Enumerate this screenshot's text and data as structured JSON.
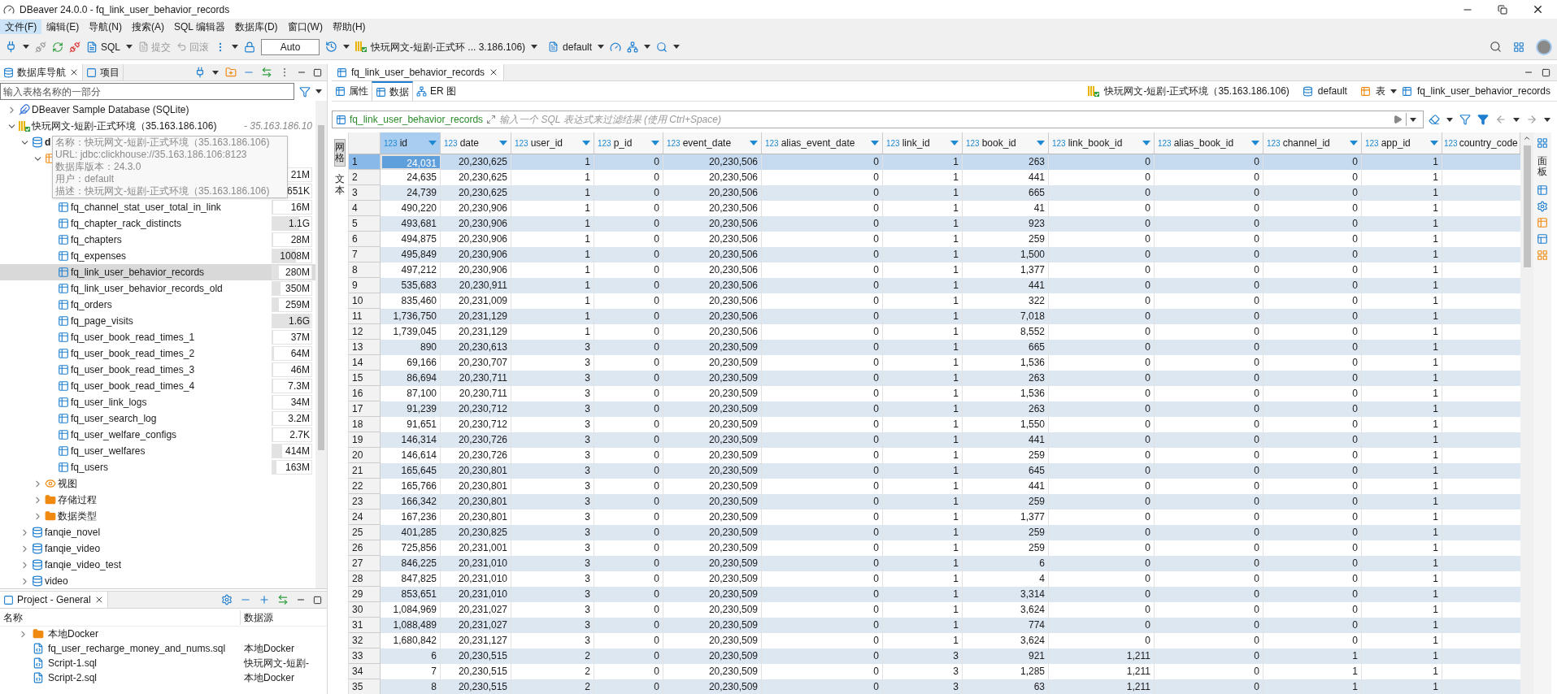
{
  "window": {
    "title": "DBeaver 24.0.0 - fq_link_user_behavior_records"
  },
  "menu": [
    {
      "label": "文件(F)",
      "selected": true
    },
    {
      "label": "编辑(E)",
      "selected": false
    },
    {
      "label": "导航(N)",
      "selected": false
    },
    {
      "label": "搜索(A)",
      "selected": false
    },
    {
      "label": "SQL 编辑器",
      "selected": false
    },
    {
      "label": "数据库(D)",
      "selected": false
    },
    {
      "label": "窗口(W)",
      "selected": false
    },
    {
      "label": "帮助(H)",
      "selected": false
    }
  ],
  "toolbar": {
    "sql": "SQL",
    "commit": "提交",
    "rollback": "回滚",
    "transaction_mode": "Auto",
    "connection": "快玩网文-短剧-正式环 ... 3.186.106)",
    "schema": "default"
  },
  "navigator": {
    "tabs": [
      {
        "label": "数据库导航",
        "selected": true,
        "closable": true
      },
      {
        "label": "项目",
        "selected": false,
        "closable": false
      }
    ],
    "filter_placeholder": "输入表格名称的一部分",
    "tree": [
      {
        "kind": "sqlite",
        "label": "DBeaver Sample Database (SQLite)",
        "expanded": false
      },
      {
        "kind": "connection",
        "label": "快玩网文-短剧-正式环境（35.163.186.106)",
        "suffix": "- 35.163.186.10",
        "expanded": true,
        "children": [
          {
            "kind": "database",
            "label": "d",
            "expanded": true,
            "children": [
              {
                "kind": "tables",
                "expanded": true,
                "children": [
                  {
                    "kind": "table",
                    "size": "21M",
                    "level": 0.02,
                    "selected": false
                  },
                  {
                    "kind": "table",
                    "size": "651K",
                    "level": 0.01,
                    "selected": false
                  },
                  {
                    "kind": "table",
                    "label": "fq_channel_stat_user_total_in_link",
                    "size": "16M",
                    "level": 0.01,
                    "selected": false
                  },
                  {
                    "kind": "table",
                    "label": "fq_chapter_rack_distincts",
                    "size": "1.1G",
                    "level": 0.68,
                    "selected": false
                  },
                  {
                    "kind": "table",
                    "label": "fq_chapters",
                    "size": "28M",
                    "level": 0.02,
                    "selected": false
                  },
                  {
                    "kind": "table",
                    "label": "fq_expenses",
                    "size": "1008M",
                    "level": 0.6,
                    "selected": false
                  },
                  {
                    "kind": "table",
                    "label": "fq_link_user_behavior_records",
                    "size": "280M",
                    "level": 0.17,
                    "selected": true
                  },
                  {
                    "kind": "table",
                    "label": "fq_link_user_behavior_records_old",
                    "size": "350M",
                    "level": 0.21,
                    "selected": false
                  },
                  {
                    "kind": "table",
                    "label": "fq_orders",
                    "size": "259M",
                    "level": 0.16,
                    "selected": false
                  },
                  {
                    "kind": "table",
                    "label": "fq_page_visits",
                    "size": "1.6G",
                    "level": 0.97,
                    "selected": false
                  },
                  {
                    "kind": "table",
                    "label": "fq_user_book_read_times_1",
                    "size": "37M",
                    "level": 0.02,
                    "selected": false
                  },
                  {
                    "kind": "table",
                    "label": "fq_user_book_read_times_2",
                    "size": "64M",
                    "level": 0.04,
                    "selected": false
                  },
                  {
                    "kind": "table",
                    "label": "fq_user_book_read_times_3",
                    "size": "46M",
                    "level": 0.03,
                    "selected": false
                  },
                  {
                    "kind": "table",
                    "label": "fq_user_book_read_times_4",
                    "size": "7.3M",
                    "level": 0.01,
                    "selected": false
                  },
                  {
                    "kind": "table",
                    "label": "fq_user_link_logs",
                    "size": "34M",
                    "level": 0.02,
                    "selected": false
                  },
                  {
                    "kind": "table",
                    "label": "fq_user_search_log",
                    "size": "3.2M",
                    "level": 0.01,
                    "selected": false
                  },
                  {
                    "kind": "table",
                    "label": "fq_user_welfare_configs",
                    "size": "2.7K",
                    "level": 0.01,
                    "selected": false
                  },
                  {
                    "kind": "table",
                    "label": "fq_user_welfares",
                    "size": "414M",
                    "level": 0.25,
                    "selected": false
                  },
                  {
                    "kind": "table",
                    "label": "fq_users",
                    "size": "163M",
                    "level": 0.1,
                    "selected": false
                  }
                ]
              },
              {
                "kind": "views",
                "label": "视图",
                "expanded": false
              },
              {
                "kind": "folder",
                "label": "存储过程",
                "expanded": false
              },
              {
                "kind": "folder",
                "label": "数据类型",
                "expanded": false
              }
            ]
          },
          {
            "kind": "database",
            "label": "fanqie_novel",
            "expanded": false
          },
          {
            "kind": "database",
            "label": "fanqie_video",
            "expanded": false
          },
          {
            "kind": "database",
            "label": "fanqie_video_test",
            "expanded": false
          },
          {
            "kind": "database",
            "label": "video",
            "expanded": false
          }
        ]
      }
    ],
    "tooltip": [
      "名称：快玩网文-短剧-正式环境（35.163.186.106)",
      "URL: jdbc:clickhouse://35.163.186.106:8123",
      "数据库版本：24.3.0",
      "用户：default",
      "描述：快玩网文-短剧-正式环境（35.163.186.106)"
    ]
  },
  "project": {
    "title": "Project - General",
    "columns": [
      "名称",
      "数据源"
    ],
    "rows": [
      {
        "kind": "folder",
        "name": "本地Docker",
        "expanded": false
      },
      {
        "kind": "script",
        "name": "fq_user_recharge_money_and_nums.sql",
        "source": "本地Docker"
      },
      {
        "kind": "script",
        "name": "Script-1.sql",
        "source": "快玩网文-短剧-"
      },
      {
        "kind": "script",
        "name": "Script-2.sql",
        "source": "本地Docker"
      }
    ]
  },
  "editor": {
    "tab": "fq_link_user_behavior_records",
    "subtabs": [
      {
        "label": "属性",
        "selected": false
      },
      {
        "label": "数据",
        "selected": true
      },
      {
        "label": "ER 图",
        "selected": false
      }
    ],
    "breadcrumb": {
      "connection": "快玩网文-短剧-正式环境（35.163.186.106)",
      "schema": "default",
      "folder": "表",
      "table": "fq_link_user_behavior_records"
    },
    "filter": {
      "table": "fq_link_user_behavior_records",
      "placeholder": "输入一个 SQL 表达式来过滤结果 (使用 Ctrl+Space)"
    },
    "view_tabs": [
      {
        "label": "网格",
        "selected": true
      },
      {
        "label": "文本",
        "selected": false
      }
    ],
    "side_panel": "面板",
    "columns": [
      {
        "type": "123",
        "name": "id",
        "selected": true
      },
      {
        "type": "123",
        "name": "date",
        "selected": false
      },
      {
        "type": "123",
        "name": "user_id",
        "selected": false
      },
      {
        "type": "123",
        "name": "p_id",
        "selected": false
      },
      {
        "type": "123",
        "name": "event_date",
        "selected": false
      },
      {
        "type": "123",
        "name": "alias_event_date",
        "selected": false
      },
      {
        "type": "123",
        "name": "link_id",
        "selected": false
      },
      {
        "type": "123",
        "name": "book_id",
        "selected": false
      },
      {
        "type": "123",
        "name": "link_book_id",
        "selected": false
      },
      {
        "type": "123",
        "name": "alias_book_id",
        "selected": false
      },
      {
        "type": "123",
        "name": "channel_id",
        "selected": false
      },
      {
        "type": "123",
        "name": "app_id",
        "selected": false
      },
      {
        "type": "123",
        "name": "country_code",
        "selected": false
      }
    ],
    "rows": [
      {
        "n": "1",
        "selected": true,
        "cells": [
          "24,031",
          "20,230,625",
          "1",
          "0",
          "20,230,506",
          "0",
          "1",
          "263",
          "0",
          "0",
          "0",
          "1"
        ]
      },
      {
        "n": "2",
        "selected": false,
        "cells": [
          "24,635",
          "20,230,625",
          "1",
          "0",
          "20,230,506",
          "0",
          "1",
          "441",
          "0",
          "0",
          "0",
          "1"
        ]
      },
      {
        "n": "3",
        "selected": false,
        "cells": [
          "24,739",
          "20,230,625",
          "1",
          "0",
          "20,230,506",
          "0",
          "1",
          "665",
          "0",
          "0",
          "0",
          "1"
        ]
      },
      {
        "n": "4",
        "selected": false,
        "cells": [
          "490,220",
          "20,230,906",
          "1",
          "0",
          "20,230,506",
          "0",
          "1",
          "41",
          "0",
          "0",
          "0",
          "1"
        ]
      },
      {
        "n": "5",
        "selected": false,
        "cells": [
          "493,681",
          "20,230,906",
          "1",
          "0",
          "20,230,506",
          "0",
          "1",
          "923",
          "0",
          "0",
          "0",
          "1"
        ]
      },
      {
        "n": "6",
        "selected": false,
        "cells": [
          "494,875",
          "20,230,906",
          "1",
          "0",
          "20,230,506",
          "0",
          "1",
          "259",
          "0",
          "0",
          "0",
          "1"
        ]
      },
      {
        "n": "7",
        "selected": false,
        "cells": [
          "495,849",
          "20,230,906",
          "1",
          "0",
          "20,230,506",
          "0",
          "1",
          "1,500",
          "0",
          "0",
          "0",
          "1"
        ]
      },
      {
        "n": "8",
        "selected": false,
        "cells": [
          "497,212",
          "20,230,906",
          "1",
          "0",
          "20,230,506",
          "0",
          "1",
          "1,377",
          "0",
          "0",
          "0",
          "1"
        ]
      },
      {
        "n": "9",
        "selected": false,
        "cells": [
          "535,683",
          "20,230,911",
          "1",
          "0",
          "20,230,506",
          "0",
          "1",
          "441",
          "0",
          "0",
          "0",
          "1"
        ]
      },
      {
        "n": "10",
        "selected": false,
        "cells": [
          "835,460",
          "20,231,009",
          "1",
          "0",
          "20,230,506",
          "0",
          "1",
          "322",
          "0",
          "0",
          "0",
          "1"
        ]
      },
      {
        "n": "11",
        "selected": false,
        "cells": [
          "1,736,750",
          "20,231,129",
          "1",
          "0",
          "20,230,506",
          "0",
          "1",
          "7,018",
          "0",
          "0",
          "0",
          "1"
        ]
      },
      {
        "n": "12",
        "selected": false,
        "cells": [
          "1,739,045",
          "20,231,129",
          "1",
          "0",
          "20,230,506",
          "0",
          "1",
          "8,552",
          "0",
          "0",
          "0",
          "1"
        ]
      },
      {
        "n": "13",
        "selected": false,
        "cells": [
          "890",
          "20,230,613",
          "3",
          "0",
          "20,230,509",
          "0",
          "1",
          "665",
          "0",
          "0",
          "0",
          "1"
        ]
      },
      {
        "n": "14",
        "selected": false,
        "cells": [
          "69,166",
          "20,230,707",
          "3",
          "0",
          "20,230,509",
          "0",
          "1",
          "1,536",
          "0",
          "0",
          "0",
          "1"
        ]
      },
      {
        "n": "15",
        "selected": false,
        "cells": [
          "86,694",
          "20,230,711",
          "3",
          "0",
          "20,230,509",
          "0",
          "1",
          "263",
          "0",
          "0",
          "0",
          "1"
        ]
      },
      {
        "n": "16",
        "selected": false,
        "cells": [
          "87,100",
          "20,230,711",
          "3",
          "0",
          "20,230,509",
          "0",
          "1",
          "1,536",
          "0",
          "0",
          "0",
          "1"
        ]
      },
      {
        "n": "17",
        "selected": false,
        "cells": [
          "91,239",
          "20,230,712",
          "3",
          "0",
          "20,230,509",
          "0",
          "1",
          "263",
          "0",
          "0",
          "0",
          "1"
        ]
      },
      {
        "n": "18",
        "selected": false,
        "cells": [
          "91,651",
          "20,230,712",
          "3",
          "0",
          "20,230,509",
          "0",
          "1",
          "1,550",
          "0",
          "0",
          "0",
          "1"
        ]
      },
      {
        "n": "19",
        "selected": false,
        "cells": [
          "146,314",
          "20,230,726",
          "3",
          "0",
          "20,230,509",
          "0",
          "1",
          "441",
          "0",
          "0",
          "0",
          "1"
        ]
      },
      {
        "n": "20",
        "selected": false,
        "cells": [
          "146,614",
          "20,230,726",
          "3",
          "0",
          "20,230,509",
          "0",
          "1",
          "259",
          "0",
          "0",
          "0",
          "1"
        ]
      },
      {
        "n": "21",
        "selected": false,
        "cells": [
          "165,645",
          "20,230,801",
          "3",
          "0",
          "20,230,509",
          "0",
          "1",
          "645",
          "0",
          "0",
          "0",
          "1"
        ]
      },
      {
        "n": "22",
        "selected": false,
        "cells": [
          "165,766",
          "20,230,801",
          "3",
          "0",
          "20,230,509",
          "0",
          "1",
          "441",
          "0",
          "0",
          "0",
          "1"
        ]
      },
      {
        "n": "23",
        "selected": false,
        "cells": [
          "166,342",
          "20,230,801",
          "3",
          "0",
          "20,230,509",
          "0",
          "1",
          "259",
          "0",
          "0",
          "0",
          "1"
        ]
      },
      {
        "n": "24",
        "selected": false,
        "cells": [
          "167,236",
          "20,230,801",
          "3",
          "0",
          "20,230,509",
          "0",
          "1",
          "1,377",
          "0",
          "0",
          "0",
          "1"
        ]
      },
      {
        "n": "25",
        "selected": false,
        "cells": [
          "401,285",
          "20,230,825",
          "3",
          "0",
          "20,230,509",
          "0",
          "1",
          "259",
          "0",
          "0",
          "0",
          "1"
        ]
      },
      {
        "n": "26",
        "selected": false,
        "cells": [
          "725,856",
          "20,231,001",
          "3",
          "0",
          "20,230,509",
          "0",
          "1",
          "259",
          "0",
          "0",
          "0",
          "1"
        ]
      },
      {
        "n": "27",
        "selected": false,
        "cells": [
          "846,225",
          "20,231,010",
          "3",
          "0",
          "20,230,509",
          "0",
          "1",
          "6",
          "0",
          "0",
          "0",
          "1"
        ]
      },
      {
        "n": "28",
        "selected": false,
        "cells": [
          "847,825",
          "20,231,010",
          "3",
          "0",
          "20,230,509",
          "0",
          "1",
          "4",
          "0",
          "0",
          "0",
          "1"
        ]
      },
      {
        "n": "29",
        "selected": false,
        "cells": [
          "853,651",
          "20,231,010",
          "3",
          "0",
          "20,230,509",
          "0",
          "1",
          "3,314",
          "0",
          "0",
          "0",
          "1"
        ]
      },
      {
        "n": "30",
        "selected": false,
        "cells": [
          "1,084,969",
          "20,231,027",
          "3",
          "0",
          "20,230,509",
          "0",
          "1",
          "3,624",
          "0",
          "0",
          "0",
          "1"
        ]
      },
      {
        "n": "31",
        "selected": false,
        "cells": [
          "1,088,489",
          "20,231,027",
          "3",
          "0",
          "20,230,509",
          "0",
          "1",
          "774",
          "0",
          "0",
          "0",
          "1"
        ]
      },
      {
        "n": "32",
        "selected": false,
        "cells": [
          "1,680,842",
          "20,231,127",
          "3",
          "0",
          "20,230,509",
          "0",
          "1",
          "3,624",
          "0",
          "0",
          "0",
          "1"
        ]
      },
      {
        "n": "33",
        "selected": false,
        "cells": [
          "6",
          "20,230,515",
          "2",
          "0",
          "20,230,509",
          "0",
          "3",
          "921",
          "1,211",
          "0",
          "1",
          "1"
        ]
      },
      {
        "n": "34",
        "selected": false,
        "cells": [
          "7",
          "20,230,515",
          "2",
          "0",
          "20,230,509",
          "0",
          "3",
          "1,285",
          "1,211",
          "0",
          "1",
          "1"
        ]
      },
      {
        "n": "35",
        "selected": false,
        "cells": [
          "8",
          "20,230,515",
          "2",
          "0",
          "20,230,509",
          "0",
          "3",
          "63",
          "1,211",
          "0",
          "1",
          "1"
        ]
      }
    ]
  }
}
